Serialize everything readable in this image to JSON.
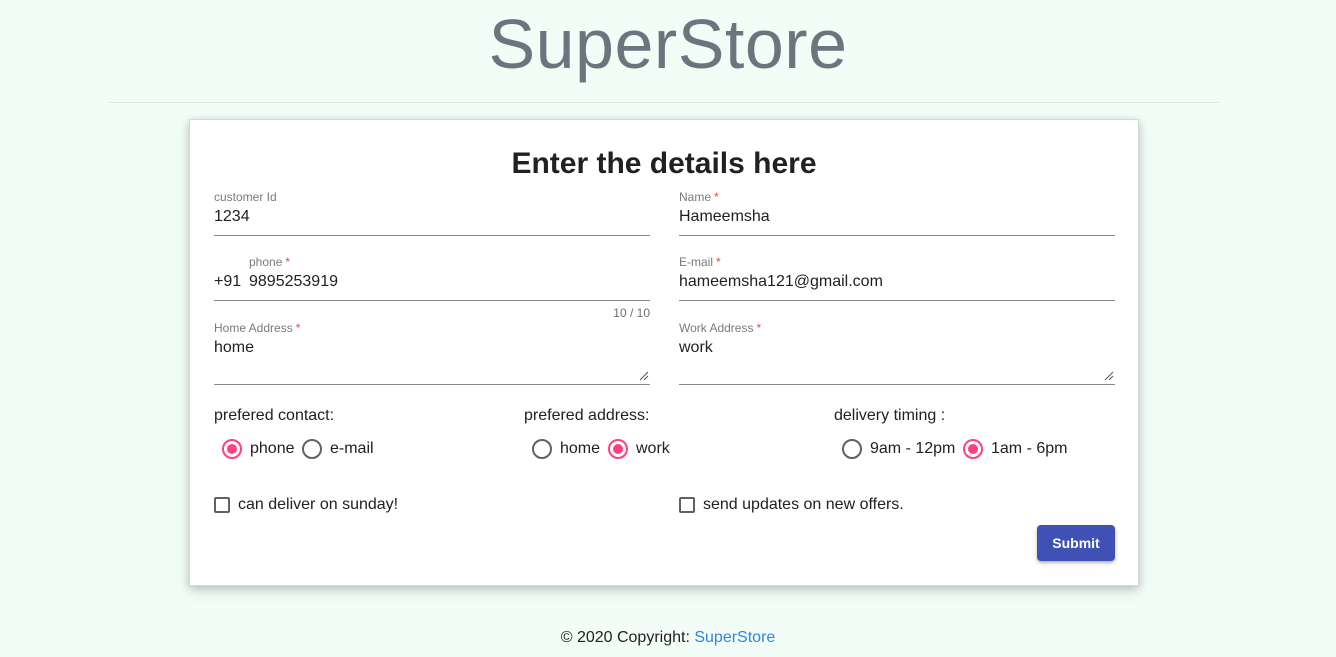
{
  "header": {
    "brand": "SuperStore"
  },
  "form": {
    "title": "Enter the details here",
    "customer_id": {
      "label": "customer Id",
      "value": "1234"
    },
    "name": {
      "label": "Name",
      "required_mark": "*",
      "value": "Hameemsha"
    },
    "phone": {
      "label": "phone",
      "required_mark": "*",
      "prefix": "+91",
      "value": "9895253919",
      "hint": "10 / 10"
    },
    "email": {
      "label": "E-mail",
      "required_mark": "*",
      "value": "hameemsha121@gmail.com"
    },
    "home_address": {
      "label": "Home Address",
      "required_mark": "*",
      "value": "home"
    },
    "work_address": {
      "label": "Work Address",
      "required_mark": "*",
      "value": "work"
    },
    "prefered_contact": {
      "label": "prefered contact:",
      "options": [
        {
          "label": "phone",
          "selected": true
        },
        {
          "label": "e-mail",
          "selected": false
        }
      ]
    },
    "prefered_address": {
      "label": "prefered address:",
      "options": [
        {
          "label": "home",
          "selected": false
        },
        {
          "label": "work",
          "selected": true
        }
      ]
    },
    "delivery_timing": {
      "label": "delivery timing :",
      "options": [
        {
          "label": "9am - 12pm",
          "selected": false
        },
        {
          "label": "1am - 6pm",
          "selected": true
        }
      ]
    },
    "sunday_checkbox": {
      "label": "can deliver on sunday!",
      "checked": false
    },
    "offers_checkbox": {
      "label": "send updates on new offers.",
      "checked": false
    },
    "submit_label": "Submit"
  },
  "footer": {
    "copyright": "© 2020 Copyright:",
    "link": "SuperStore"
  },
  "colors": {
    "background": "#f2fdf7",
    "accent_radio": "#ff4081",
    "primary_button": "#3f51b5",
    "link": "#2e86de",
    "required": "#f44336"
  }
}
